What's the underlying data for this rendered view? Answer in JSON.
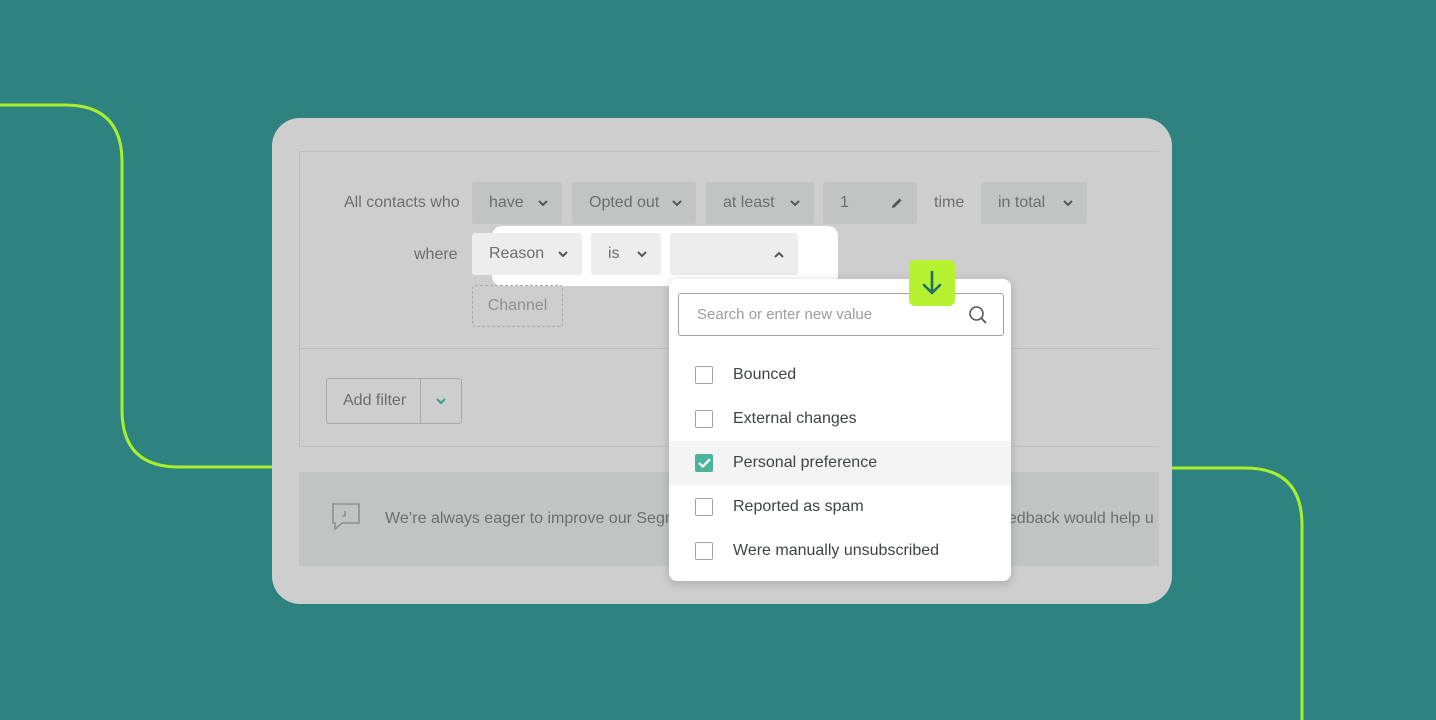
{
  "colors": {
    "background": "#2e8280",
    "accent_line": "#a8ef2e",
    "badge": "#b6f22f",
    "checkbox_checked": "#4db39a"
  },
  "filter": {
    "row1": {
      "prefix": "All contacts who",
      "have": "have",
      "event": "Opted out",
      "quantifier": "at least",
      "count": "1",
      "unit": "time",
      "period": "in total"
    },
    "row2": {
      "prefix": "where",
      "field": "Reason",
      "operator": "is",
      "value": ""
    },
    "extra_option": "Channel",
    "add_filter_label": "Add filter"
  },
  "dropdown": {
    "search_placeholder": "Search or enter new value",
    "options": [
      {
        "label": "Bounced",
        "checked": false
      },
      {
        "label": "External changes",
        "checked": false
      },
      {
        "label": "Personal preference",
        "checked": true
      },
      {
        "label": "Reported as spam",
        "checked": false
      },
      {
        "label": "Were manually unsubscribed",
        "checked": false
      }
    ]
  },
  "feedback": {
    "text_left": "We’re always eager to improve our Segment",
    "text_right": "eedback would help u"
  },
  "icons": {
    "badge": "arrow-down-icon",
    "search": "search-icon",
    "edit": "pencil-icon",
    "feedback": "speech-bubble-icon"
  }
}
